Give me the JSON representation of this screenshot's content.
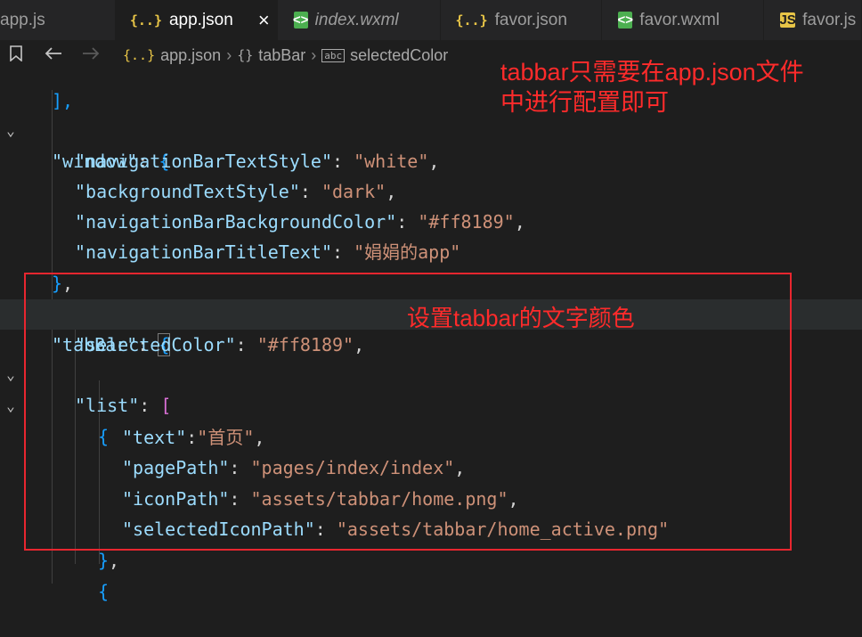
{
  "tabs": [
    {
      "name": "app.js",
      "icon": "js-file-icon",
      "active": false,
      "italic": false
    },
    {
      "name": "app.json",
      "icon": "json-file-icon",
      "active": true,
      "italic": false,
      "close": "×"
    },
    {
      "name": "index.wxml",
      "icon": "wxml-file-icon",
      "active": false,
      "italic": true
    },
    {
      "name": "favor.json",
      "icon": "json-file-icon",
      "active": false,
      "italic": false
    },
    {
      "name": "favor.wxml",
      "icon": "wxml-file-icon",
      "active": false,
      "italic": false
    },
    {
      "name": "favor.js",
      "icon": "js-file-icon",
      "active": false,
      "italic": false
    }
  ],
  "breadcrumb": {
    "file": "app.json",
    "segment1": "tabBar",
    "segment2": "selectedColor"
  },
  "code": {
    "l0": "],",
    "l1_key": "\"window\"",
    "l2_key": "\"navigationBarTextStyle\"",
    "l2_val": "\"white\"",
    "l3_key": "\"backgroundTextStyle\"",
    "l3_val": "\"dark\"",
    "l4_key": "\"navigationBarBackgroundColor\"",
    "l4_val": "\"#ff8189\"",
    "l5_key": "\"navigationBarTitleText\"",
    "l5_val": "\"娟娟的app\"",
    "l7_key": "\"tabBar\"",
    "l8_key": "\"selectedColor\"",
    "l8_val": "\"#ff8189\"",
    "l9_key": "\"list\"",
    "l11_key": "\"text\"",
    "l11_val": "\"首页\"",
    "l12_key": "\"pagePath\"",
    "l12_val": "\"pages/index/index\"",
    "l13_key": "\"iconPath\"",
    "l13_val": "\"assets/tabbar/home.png\"",
    "l14_key": "\"selectedIconPath\"",
    "l14_val": "\"assets/tabbar/home_active.png\""
  },
  "annotations": {
    "top_line1": "tabbar只需要在app.json文件",
    "top_line2": "中进行配置即可",
    "selected_color": "设置tabbar的文字颜色"
  },
  "colors": {
    "annotation": "#ff2b2b",
    "highlight_box": "#e8262f",
    "key": "#9cdcfe",
    "string": "#ce9178"
  }
}
